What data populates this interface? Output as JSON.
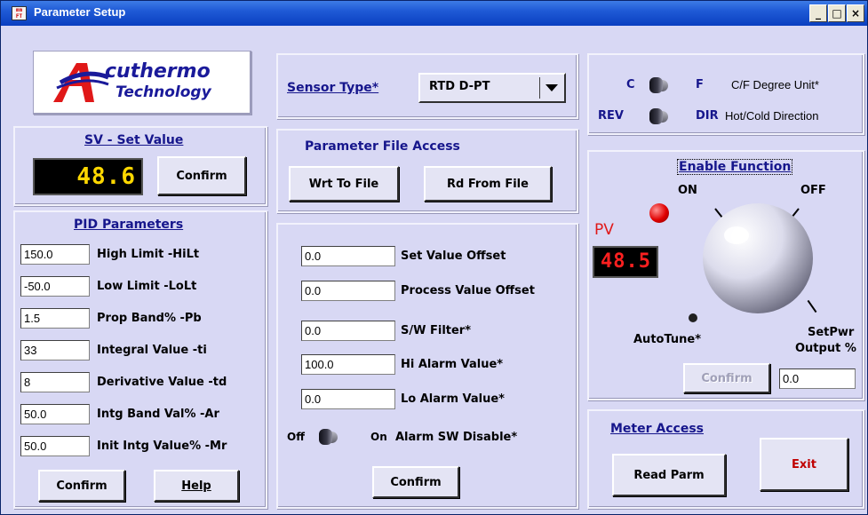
{
  "window": {
    "title": "Parameter Setup",
    "minimize": "_",
    "maximize": "□",
    "close": "×"
  },
  "logo": {
    "line1": "cuthermo",
    "line2": "Technology"
  },
  "sv": {
    "header": "SV - Set Value",
    "display": "48.6",
    "confirm": "Confirm"
  },
  "pid": {
    "header": "PID Parameters",
    "rows": [
      {
        "value": "150.0",
        "label": "High Limit -HiLt"
      },
      {
        "value": "-50.0",
        "label": "Low Limit -LoLt"
      },
      {
        "value": "1.5",
        "label": "Prop Band% -Pb"
      },
      {
        "value": "33",
        "label": "Integral Value -ti"
      },
      {
        "value": "8",
        "label": "Derivative Value -td"
      },
      {
        "value": "50.0",
        "label": "Intg Band Val% -Ar"
      },
      {
        "value": "50.0",
        "label": "Init Intg Value% -Mr"
      }
    ],
    "confirm": "Confirm",
    "help": "Help"
  },
  "sensor": {
    "label": "Sensor Type*",
    "value": "RTD D-PT"
  },
  "file": {
    "header": "Parameter File Access",
    "write": "Wrt To File",
    "read": "Rd From File"
  },
  "offsets": {
    "rows": [
      {
        "value": "0.0",
        "label": "Set Value Offset"
      },
      {
        "value": "0.0",
        "label": "Process Value Offset"
      },
      {
        "value": "0.0",
        "label": "S/W Filter*"
      },
      {
        "value": "100.0",
        "label": "Hi Alarm Value*"
      },
      {
        "value": "0.0",
        "label": "Lo Alarm Value*"
      }
    ],
    "alarm_off": "Off",
    "alarm_on": "On",
    "alarm_label": "Alarm SW Disable*",
    "confirm": "Confirm"
  },
  "units": {
    "c": "C",
    "f": "F",
    "degree_label": "C/F Degree Unit*",
    "rev": "REV",
    "dir": "DIR",
    "direction_label": "Hot/Cold Direction"
  },
  "enable": {
    "header": "Enable Function",
    "on": "ON",
    "off": "OFF",
    "pv_label": "PV",
    "pv_display": "48.5",
    "autotune": "AutoTune*",
    "setpwr_line1": "SetPwr",
    "setpwr_line2": "Output %",
    "confirm": "Confirm",
    "output_value": "0.0"
  },
  "meter": {
    "header": "Meter Access",
    "read": "Read Parm",
    "exit": "Exit"
  },
  "colors": {
    "panel": "#d8d8f4",
    "header_text": "#16168c",
    "led_yellow": "#ffd800",
    "led_red": "#ff2020",
    "exit_red": "#c00000"
  }
}
